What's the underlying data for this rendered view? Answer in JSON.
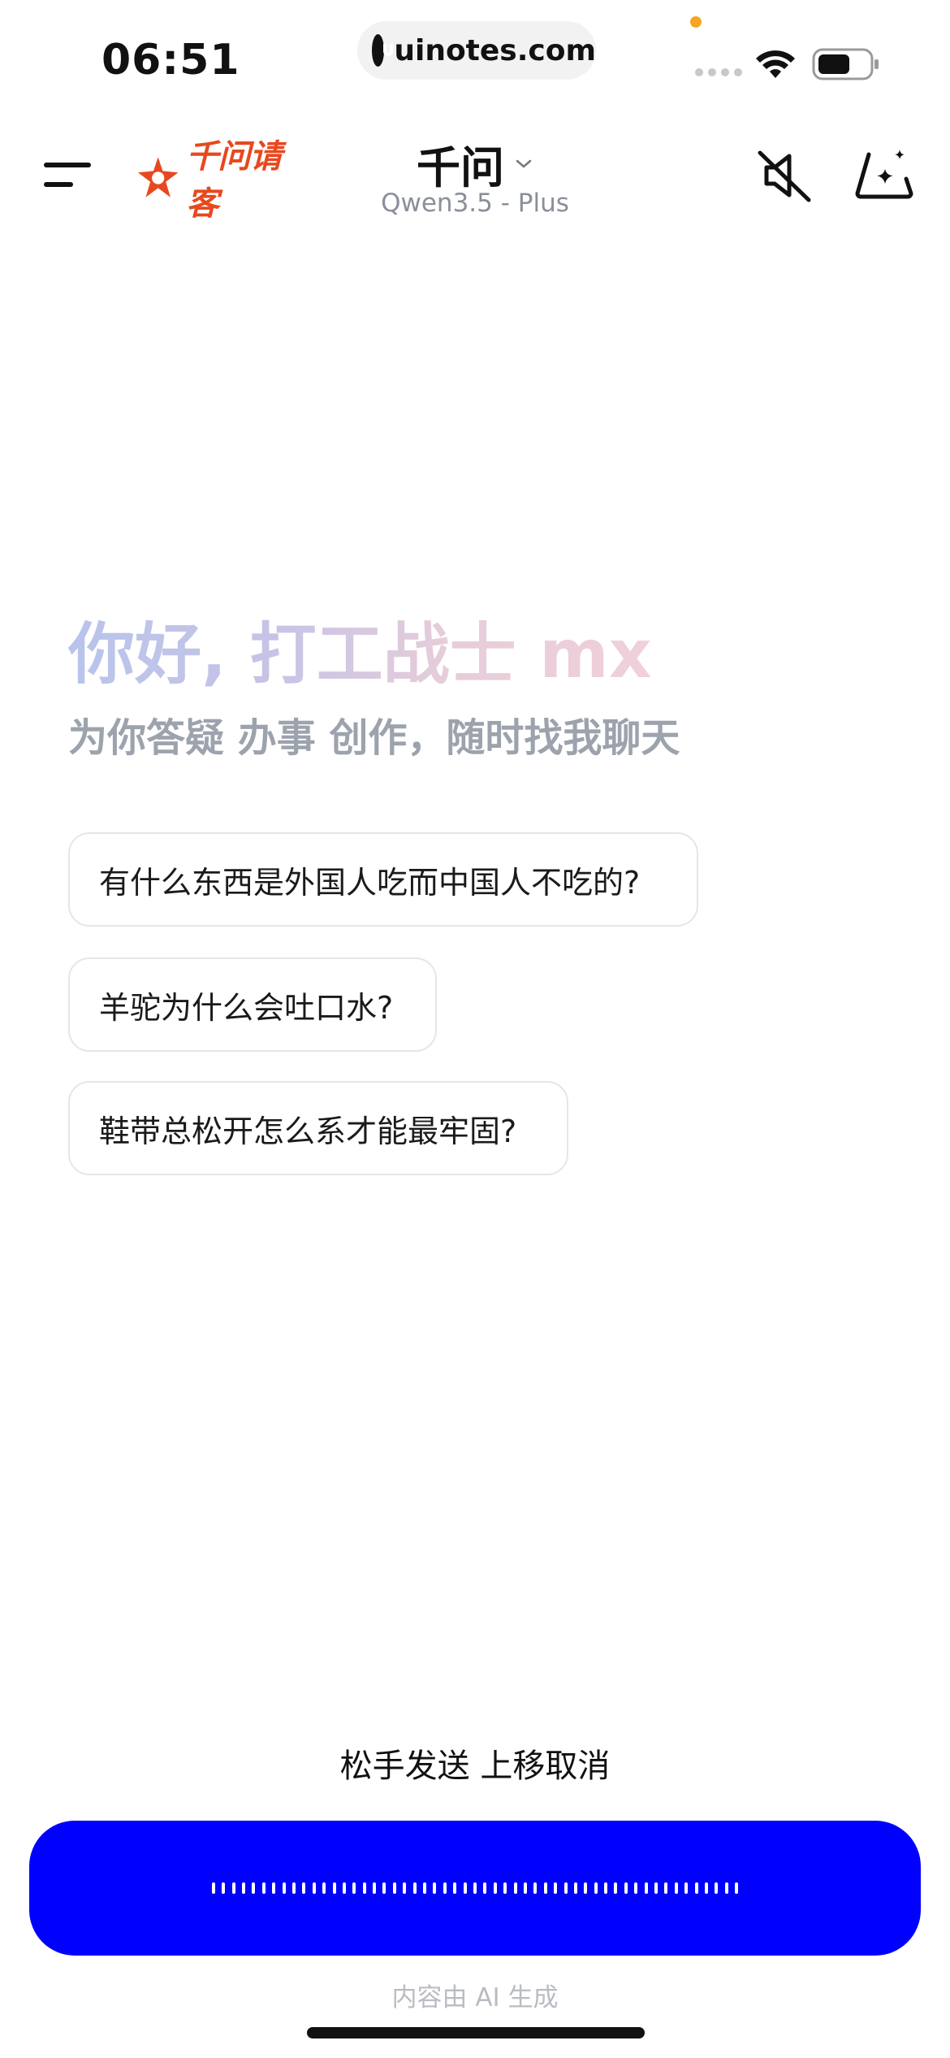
{
  "status_bar": {
    "time": "06:51",
    "url": "uinotes.com",
    "icons": [
      "signal-dots-icon",
      "wifi-icon",
      "battery-icon"
    ]
  },
  "header": {
    "brand": "千问请客",
    "model_name": "千问",
    "model_version": "Qwen3.5 - Plus",
    "icons": [
      "menu-icon",
      "chevron-down-icon",
      "speaker-mute-icon",
      "new-chat-sparkle-icon"
    ]
  },
  "greeting": {
    "title": "你好, 打工战士 mx",
    "subtitle": "为你答疑 办事 创作，随时找我聊天"
  },
  "suggestions": [
    "有什么东西是外国人吃而中国人不吃的?",
    "羊驼为什么会吐口水?",
    "鞋带总松开怎么系才能最牢固?"
  ],
  "recording": {
    "hint": "松手发送 上移取消",
    "bar_color": "#0000ff"
  },
  "footer": {
    "note": "内容由 AI 生成"
  },
  "colors": {
    "brand": "#e8481f",
    "accent": "#0000ff"
  }
}
